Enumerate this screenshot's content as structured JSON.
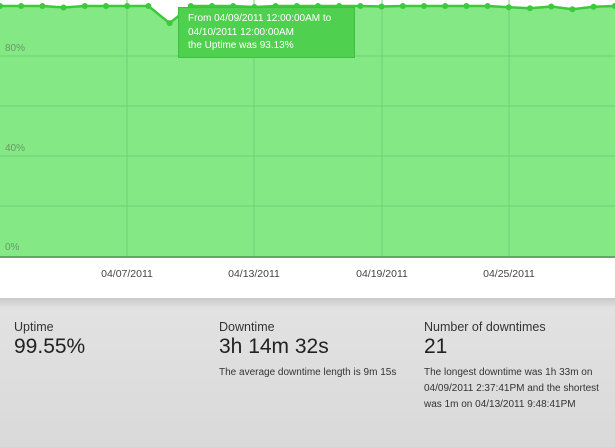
{
  "chart_data": {
    "type": "area",
    "yticks": [
      "80%",
      "40%",
      "0%"
    ],
    "ylim": [
      0,
      100
    ],
    "xticks": [
      "04/07/2011",
      "04/13/2011",
      "04/19/2011",
      "04/25/2011"
    ],
    "grid": true,
    "colors": {
      "fill": "#84e884",
      "line": "#3cc93c",
      "grid": "#6fd06f"
    },
    "x": [
      "04/01/2011",
      "04/02/2011",
      "04/03/2011",
      "04/04/2011",
      "04/05/2011",
      "04/06/2011",
      "04/07/2011",
      "04/08/2011",
      "04/09/2011",
      "04/10/2011",
      "04/11/2011",
      "04/12/2011",
      "04/13/2011",
      "04/14/2011",
      "04/15/2011",
      "04/16/2011",
      "04/17/2011",
      "04/18/2011",
      "04/19/2011",
      "04/20/2011",
      "04/21/2011",
      "04/22/2011",
      "04/23/2011",
      "04/24/2011",
      "04/25/2011",
      "04/26/2011",
      "04/27/2011",
      "04/28/2011",
      "04/29/2011",
      "04/30/2011"
    ],
    "values": [
      100,
      100,
      100,
      99.4,
      100,
      100,
      100,
      100,
      93.13,
      100,
      100,
      100,
      99.6,
      100,
      100,
      100,
      100,
      100,
      99.8,
      100,
      100,
      100,
      100,
      100,
      99.5,
      99.1,
      99.8,
      98.7,
      99.7,
      100
    ]
  },
  "tooltip": {
    "line1": "From 04/09/2011 12:00:00AM to",
    "line2": "04/10/2011 12:00:00AM",
    "line3": "the Uptime was 93.13%"
  },
  "stats": {
    "uptime": {
      "label": "Uptime",
      "value": "99.55%"
    },
    "downtime": {
      "label": "Downtime",
      "value": "3h 14m 32s",
      "note": "The average downtime length is 9m 15s"
    },
    "downtimes": {
      "label": "Number of downtimes",
      "value": "21",
      "note": "The longest downtime was 1h 33m on 04/09/2011 2:37:41PM and the shortest was 1m on 04/13/2011 9:48:41PM"
    }
  }
}
